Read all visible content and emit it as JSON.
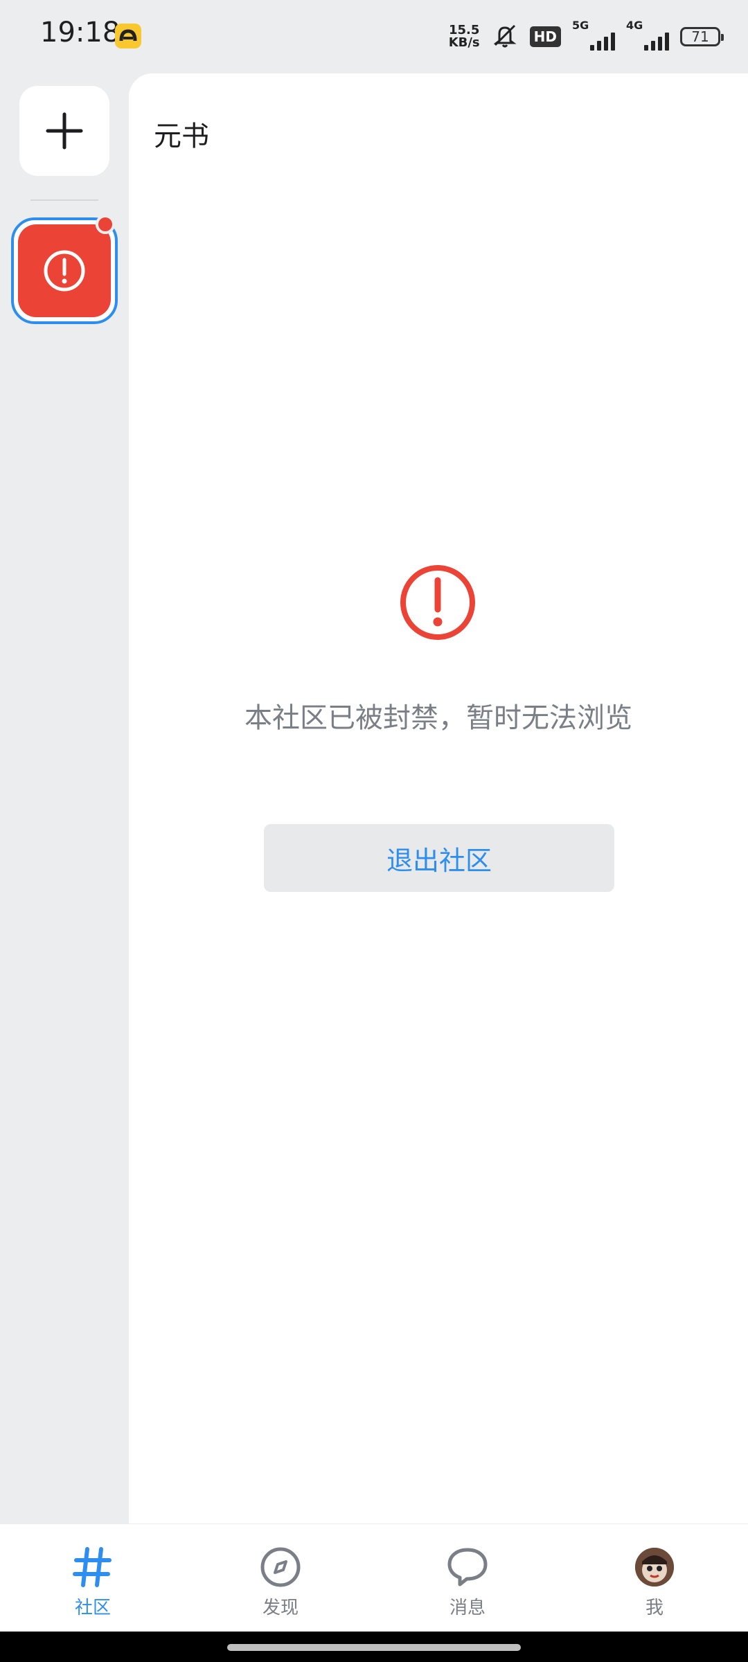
{
  "status_bar": {
    "time": "19:18",
    "net_speed_value": "15.5",
    "net_speed_unit": "KB/s",
    "hd_label": "HD",
    "signal_1_label": "5G",
    "signal_2_label": "4G",
    "battery": "71"
  },
  "main": {
    "community_name": "元书",
    "banned_message": "本社区已被封禁，暂时无法浏览",
    "exit_button_label": "退出社区"
  },
  "bottom_nav": {
    "items": [
      {
        "label": "社区",
        "icon": "hash-icon",
        "active": true
      },
      {
        "label": "发现",
        "icon": "compass-icon",
        "active": false
      },
      {
        "label": "消息",
        "icon": "chat-bubble-icon",
        "active": false
      },
      {
        "label": "我",
        "icon": "avatar",
        "active": false
      }
    ]
  },
  "colors": {
    "accent": "#2E8EEF",
    "error": "#EB4335",
    "muted_text": "#7A7E86",
    "rail_bg": "#ECEDEF"
  }
}
